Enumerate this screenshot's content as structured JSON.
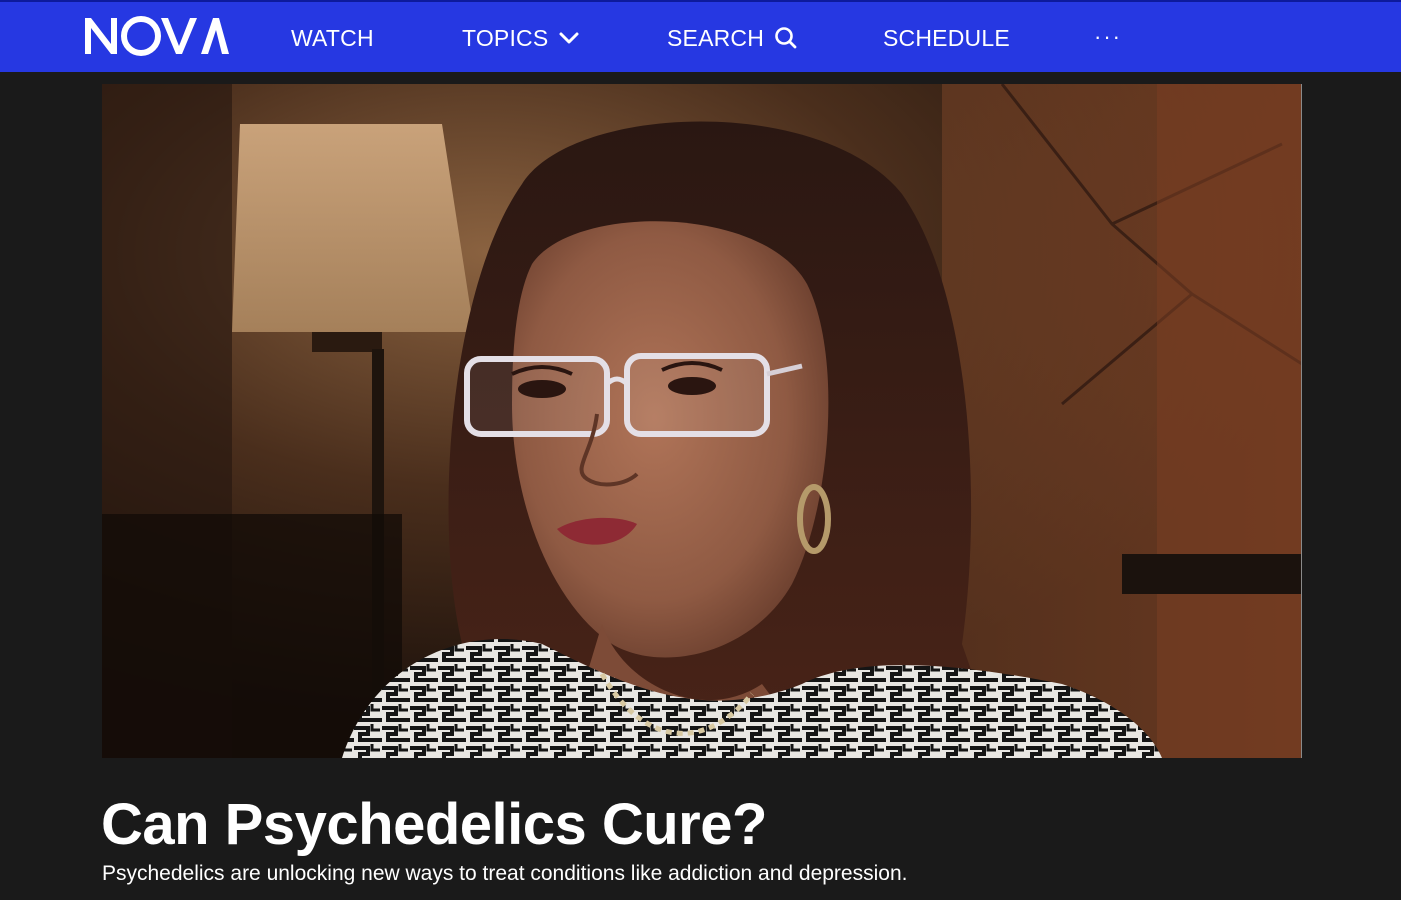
{
  "header": {
    "logo_text": "NOVA",
    "nav": {
      "watch": "WATCH",
      "topics": "TOPICS",
      "search": "SEARCH",
      "schedule": "SCHEDULE",
      "more": "···"
    },
    "icons": {
      "topics": "chevron-down-icon",
      "search": "search-icon",
      "more": "more-dots-icon"
    },
    "brand_color": "#2638e2"
  },
  "hero": {
    "image_subject": "woman-with-glasses-portrait"
  },
  "article": {
    "title": "Can Psychedelics Cure?",
    "subtitle": "Psychedelics are unlocking new ways to treat conditions like addiction and depression."
  },
  "colors": {
    "page_background": "#1a1a1a",
    "text": "#ffffff"
  }
}
